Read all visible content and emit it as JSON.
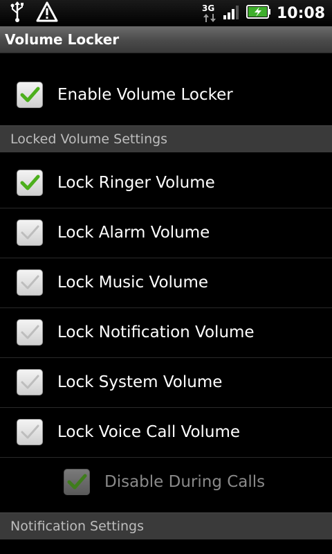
{
  "status_bar": {
    "clock": "10:08",
    "network_label": "3G",
    "icons": [
      "usb-icon",
      "warning-icon",
      "network-3g-icon",
      "signal-icon",
      "battery-charging-icon"
    ]
  },
  "title_bar": {
    "title": "Volume Locker"
  },
  "preferences": {
    "enable": {
      "label": "Enable Volume Locker",
      "checked": true
    },
    "locked_header": "Locked Volume Settings",
    "items": [
      {
        "label": "Lock Ringer Volume",
        "checked": true
      },
      {
        "label": "Lock Alarm Volume",
        "checked": false
      },
      {
        "label": "Lock Music Volume",
        "checked": false
      },
      {
        "label": "Lock Notification Volume",
        "checked": false
      },
      {
        "label": "Lock System Volume",
        "checked": false
      },
      {
        "label": "Lock Voice Call Volume",
        "checked": false
      }
    ],
    "disable_during_calls": {
      "label": "Disable During Calls",
      "checked": true,
      "enabled": false
    },
    "notification_header": "Notification Settings"
  },
  "colors": {
    "check_green": "#4caf1c",
    "check_grey": "#b8b8b8",
    "category_bg": "#3a3a3a"
  }
}
